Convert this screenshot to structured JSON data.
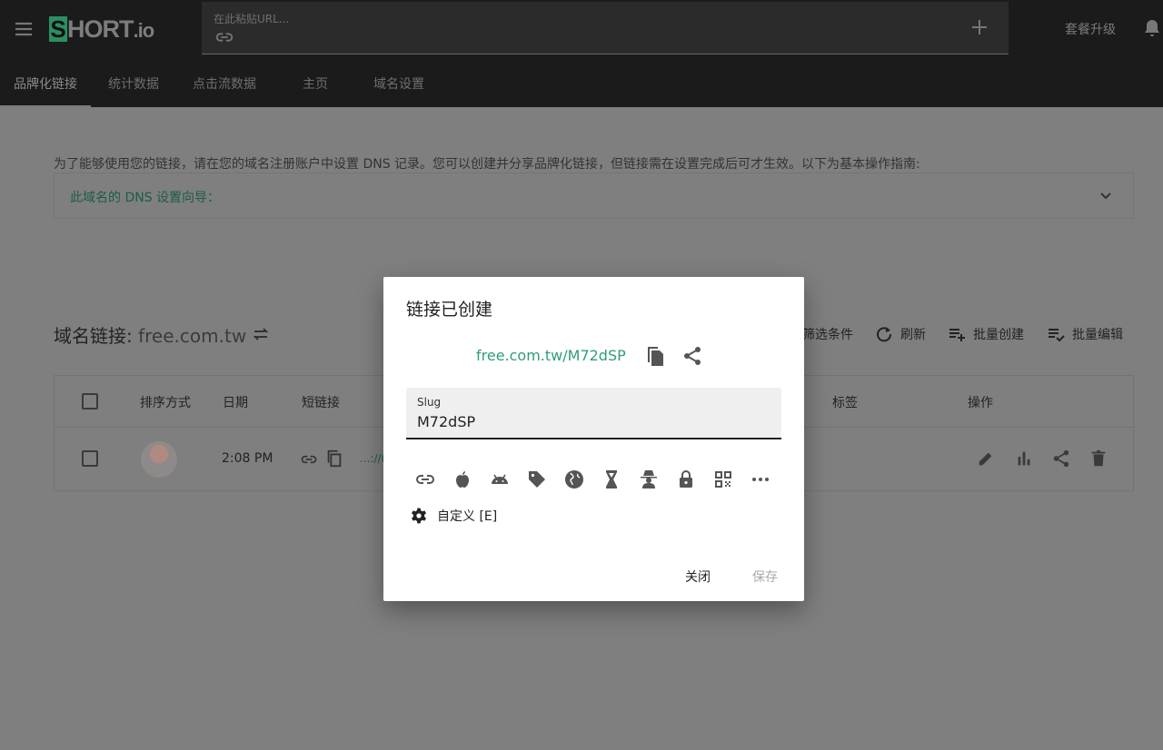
{
  "header": {
    "logo_mark": "S",
    "logo_text": "HORT",
    "logo_suffix": ".io",
    "url_placeholder": "在此粘贴URL...",
    "upgrade_label": "套餐升级",
    "icons": [
      "menu-icon",
      "link-icon",
      "plus-icon",
      "bell-icon"
    ]
  },
  "tabs": [
    {
      "label": "品牌化链接",
      "active": true
    },
    {
      "label": "统计数据",
      "active": false
    },
    {
      "label": "点击流数据",
      "active": false
    },
    {
      "label": "主页",
      "active": false
    },
    {
      "label": "域名设置",
      "active": false
    }
  ],
  "notice": {
    "text": "为了能够使用您的链接，请在您的域名注册账户中设置 DNS 记录。您可以创建并分享品牌化链接，但链接需在设置完成后可才生效。以下为基本操作指南:",
    "guide_label": "此域名的 DNS 设置向导："
  },
  "domain": {
    "title": "域名链接: ",
    "name": "free.com.tw"
  },
  "toolbar": {
    "filter_label": "筛选条件",
    "refresh_label": "刷新",
    "bulk_create_label": "批量创建",
    "bulk_edit_label": "批量编辑"
  },
  "table": {
    "headers": {
      "sort": "排序方式",
      "date": "日期",
      "short_link": "短链接",
      "tags": "标签",
      "actions": "操作"
    },
    "rows": [
      {
        "time": "2:08 PM",
        "short_fragment": "...://("
      }
    ]
  },
  "dialog": {
    "title": "链接已创建",
    "link": "free.com.tw/M72dSP",
    "slug_label": "Slug",
    "slug_value": "M72dSP",
    "option_icons": [
      "link-icon",
      "apple-icon",
      "android-icon",
      "tag-icon",
      "globe-icon",
      "hourglass-icon",
      "incognito-icon",
      "lock-icon",
      "qr-code-icon",
      "more-icon"
    ],
    "custom_label": "自定义 [E]",
    "close_label": "关闭",
    "save_label": "保存"
  },
  "colors": {
    "accent": "#2e9e77",
    "header_bg": "#1b1b1b",
    "overlay_bg": "#7f7f7f"
  }
}
